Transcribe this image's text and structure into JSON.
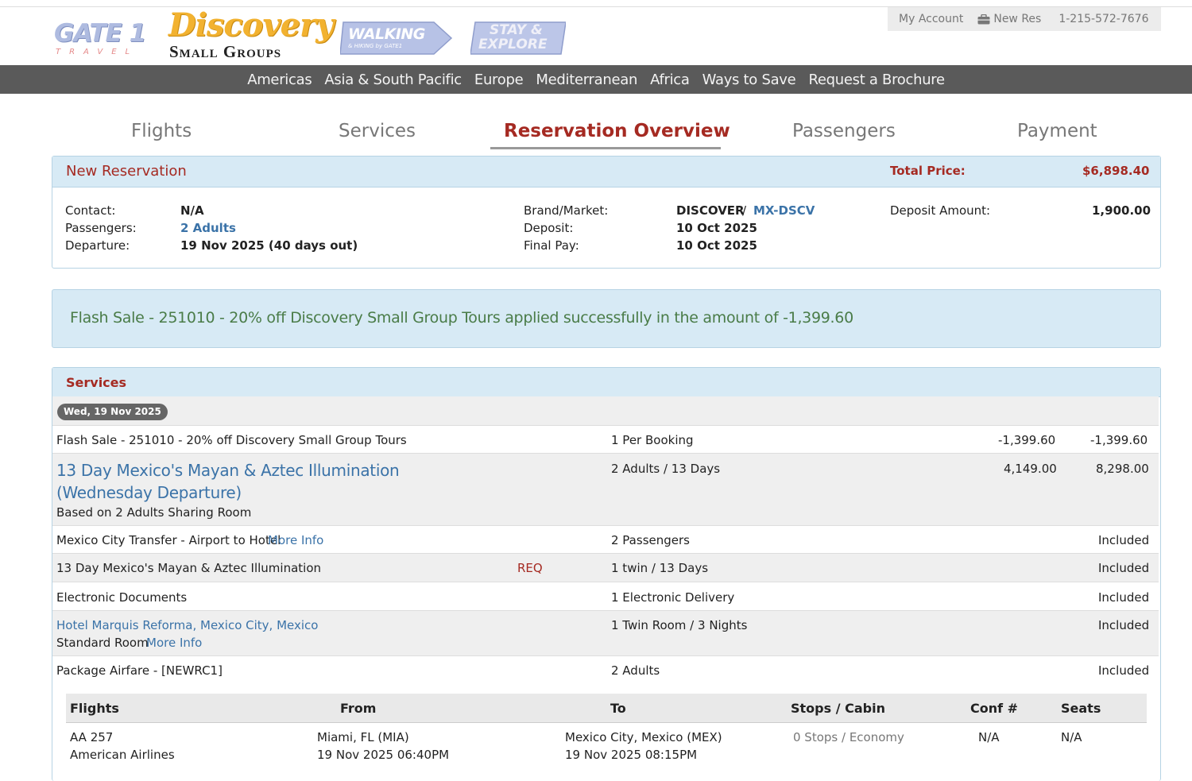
{
  "header": {
    "account": "My Account",
    "new_res": "New Res",
    "phone": "1-215-572-7676",
    "logos": {
      "gate1_big": "GATE 1",
      "gate1_small": "TRAVEL",
      "discovery_big": "Discovery",
      "discovery_small": "Small Groups",
      "walking_big": "WALKING",
      "walking_small": "& HIKING by GATE1",
      "stay_big": "STAY &",
      "stay_small": "EXPLORE"
    }
  },
  "nav": [
    "Americas",
    "Asia & South Pacific",
    "Europe",
    "Mediterranean",
    "Africa",
    "Ways to Save",
    "Request a Brochure"
  ],
  "steps": {
    "flights": "Flights",
    "services": "Services",
    "overview": "Reservation Overview",
    "passengers": "Passengers",
    "payment": "Payment"
  },
  "reservation": {
    "title": "New Reservation",
    "total_label": "Total Price:",
    "total_value": "$6,898.40",
    "contact_label": "Contact:",
    "contact_value": "N/A",
    "passengers_label": "Passengers:",
    "passengers_value": "2 Adults",
    "departure_label": "Departure:",
    "departure_value": "19 Nov 2025 (40 days out)",
    "brand_label": "Brand/Market:",
    "brand_value": "DISCOVER",
    "brand_sep": "/",
    "market_value": "MX-DSCV",
    "deposit_label": "Deposit:",
    "deposit_value": "10 Oct 2025",
    "finalpay_label": "Final Pay:",
    "finalpay_value": "10 Oct 2025",
    "deposit_amount_label": "Deposit Amount:",
    "deposit_amount_value": "1,900.00"
  },
  "flash_message": "Flash Sale - 251010 - 20% off Discovery Small Group Tours applied successfully in the amount of -1,399.60",
  "services": {
    "title": "Services",
    "date_badge": "Wed, 19 Nov 2025",
    "more_info": "More Info",
    "rows": [
      {
        "name": "Flash Sale - 251010 - 20% off Discovery Small Group Tours",
        "qty": "1 Per Booking",
        "unit": "-1,399.60",
        "total": "-1,399.60"
      },
      {
        "name": "13 Day Mexico's Mayan & Aztec Illumination (Wednesday Departure)",
        "sub": "Based on 2 Adults Sharing Room",
        "qty": "2 Adults / 13 Days",
        "unit": "4,149.00",
        "total": "8,298.00"
      },
      {
        "name": "Mexico City Transfer - Airport to Hotel",
        "qty": "2 Passengers",
        "total": "Included"
      },
      {
        "name": "13 Day Mexico's Mayan & Aztec Illumination",
        "status": "REQ",
        "qty": "1 twin / 13 Days",
        "total": "Included"
      },
      {
        "name": "Electronic Documents",
        "qty": "1 Electronic Delivery",
        "total": "Included"
      },
      {
        "name": "Hotel Marquis Reforma, Mexico City, Mexico",
        "sub": "Standard Room",
        "qty": "1 Twin Room / 3 Nights",
        "total": "Included"
      },
      {
        "name": "Package Airfare - [NEWRC1]",
        "qty": "2 Adults",
        "total": "Included"
      }
    ]
  },
  "flights": {
    "headers": [
      "Flights",
      "From",
      "To",
      "Stops / Cabin",
      "Conf #",
      "Seats"
    ],
    "rows": [
      {
        "flight": "AA 257",
        "airline": "American Airlines",
        "from": "Miami, FL (MIA)",
        "from_time": "19 Nov 2025 06:40PM",
        "to": "Mexico City, Mexico (MEX)",
        "to_time": "19 Nov 2025 08:15PM",
        "stops": "0 Stops / Economy",
        "conf": "N/A",
        "seats": "N/A"
      }
    ]
  }
}
